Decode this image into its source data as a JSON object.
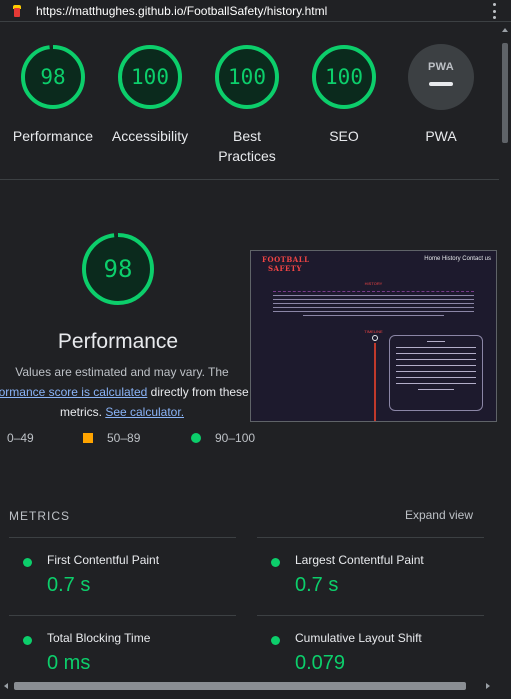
{
  "browser": {
    "url": "https://matthughes.github.io/FootballSafety/history.html"
  },
  "colors": {
    "pass": "#0cce6b",
    "average": "#ffa400",
    "background": "#202124",
    "link": "#8ab4f8"
  },
  "gauges": [
    {
      "score": "98",
      "label": "Performance",
      "value_fraction": 0.98
    },
    {
      "score": "100",
      "label": "Accessibility",
      "value_fraction": 1.0
    },
    {
      "score": "100",
      "label": "Best Practices",
      "value_fraction": 1.0
    },
    {
      "score": "100",
      "label": "SEO",
      "value_fraction": 1.0
    }
  ],
  "pwa": {
    "badge": "PWA",
    "label": "PWA"
  },
  "performance": {
    "score": "98",
    "value_fraction": 0.98,
    "title": "Performance",
    "desc_line1": "Values are estimated and may vary. The",
    "desc_link1": "formance score is calculated",
    "desc_mid": " directly from these",
    "desc_line3_pre": "metrics. ",
    "desc_link2": "See calculator."
  },
  "legend": {
    "fail": "0–49",
    "average": "50–89",
    "pass": "90–100"
  },
  "thumbnail": {
    "brand_line1": "FOOTBALL",
    "brand_line2": "SAFETY",
    "nav": "Home History Contact us",
    "heading": "HISTORY",
    "subheading": "TIMELINE"
  },
  "metrics": {
    "header": "METRICS",
    "expand_label": "Expand view",
    "items": [
      {
        "title": "First Contentful Paint",
        "value": "0.7 s"
      },
      {
        "title": "Largest Contentful Paint",
        "value": "0.7 s"
      },
      {
        "title": "Total Blocking Time",
        "value": "0 ms"
      },
      {
        "title": "Cumulative Layout Shift",
        "value": "0.079"
      }
    ]
  }
}
